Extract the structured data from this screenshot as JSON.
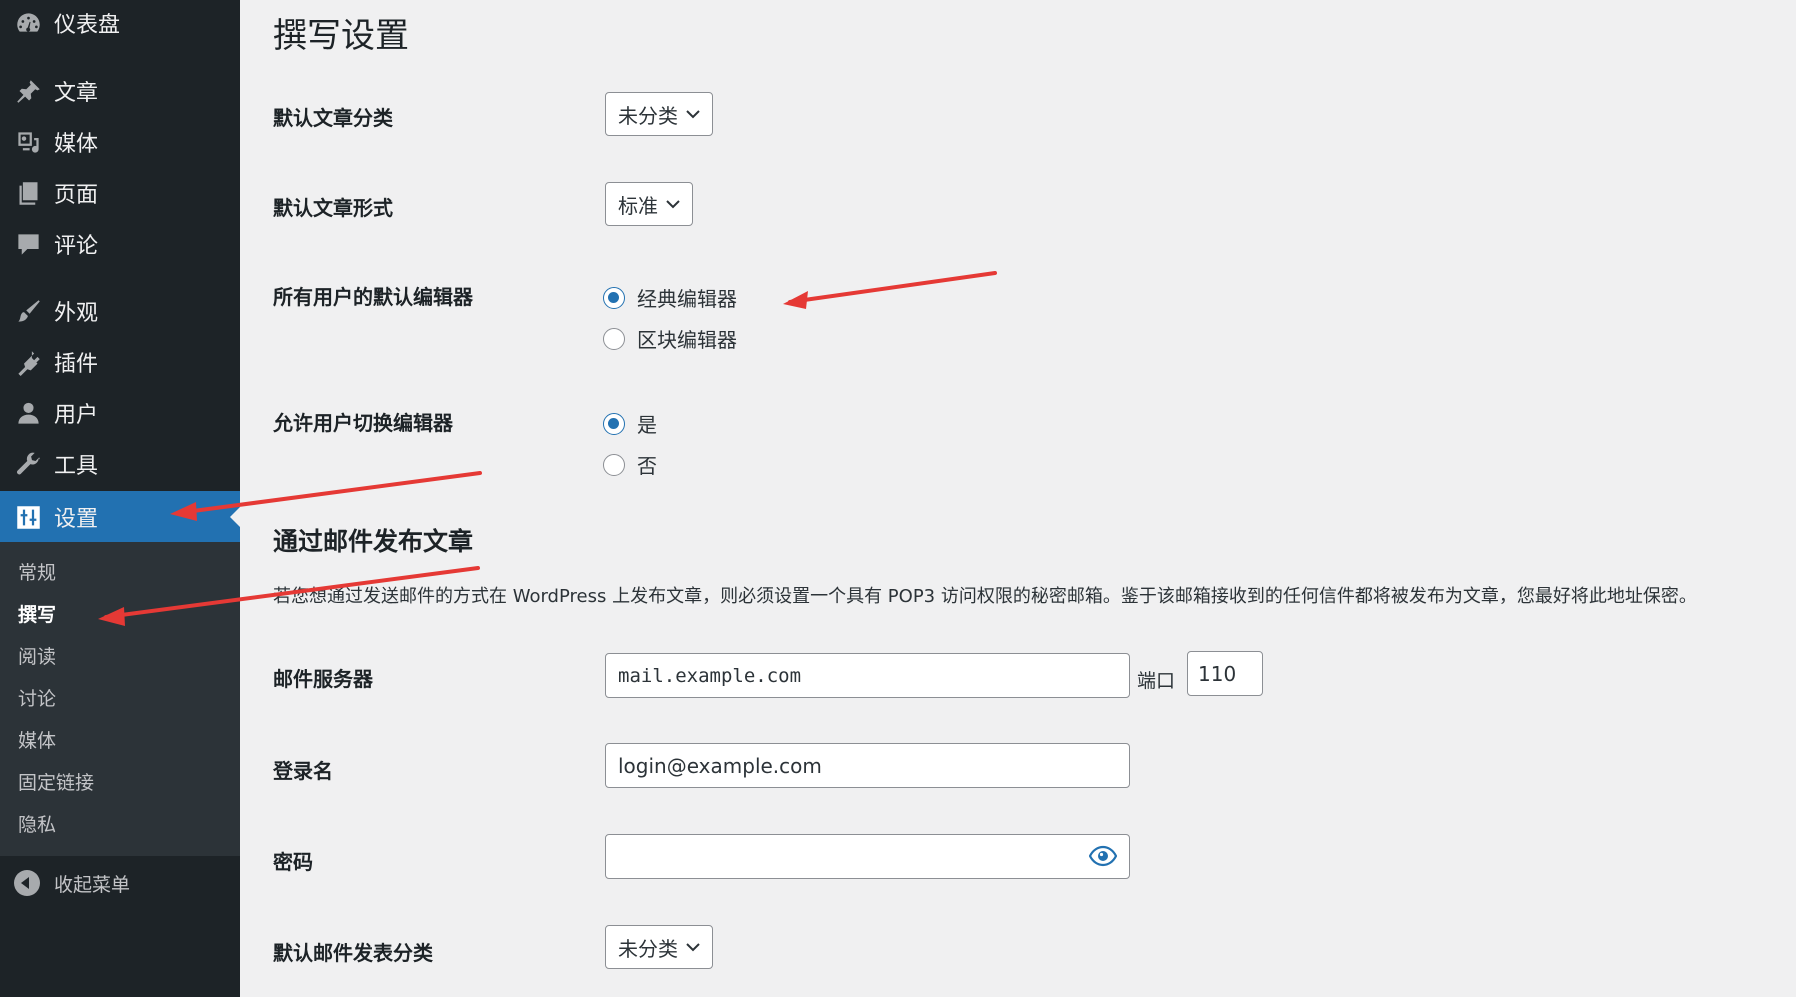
{
  "sidebar": {
    "items": [
      {
        "label": "仪表盘",
        "icon": "dashboard-icon"
      },
      {
        "label": "文章",
        "icon": "pin-icon"
      },
      {
        "label": "媒体",
        "icon": "media-icon"
      },
      {
        "label": "页面",
        "icon": "page-icon"
      },
      {
        "label": "评论",
        "icon": "comment-icon"
      },
      {
        "label": "外观",
        "icon": "brush-icon"
      },
      {
        "label": "插件",
        "icon": "plugin-icon"
      },
      {
        "label": "用户",
        "icon": "user-icon"
      },
      {
        "label": "工具",
        "icon": "wrench-icon"
      },
      {
        "label": "设置",
        "icon": "settings-icon",
        "current": true
      }
    ],
    "submenu": [
      "常规",
      "撰写",
      "阅读",
      "讨论",
      "媒体",
      "固定链接",
      "隐私"
    ],
    "submenu_current": "撰写",
    "collapse_label": "收起菜单"
  },
  "page": {
    "title": "撰写设置",
    "default_category": {
      "label": "默认文章分类",
      "value": "未分类"
    },
    "default_format": {
      "label": "默认文章形式",
      "value": "标准"
    },
    "default_editor": {
      "label": "所有用户的默认编辑器",
      "options": [
        "经典编辑器",
        "区块编辑器"
      ],
      "selected": "经典编辑器"
    },
    "allow_switch": {
      "label": "允许用户切换编辑器",
      "options": [
        "是",
        "否"
      ],
      "selected": "是"
    },
    "email_section": {
      "title": "通过邮件发布文章",
      "description": "若您想通过发送邮件的方式在 WordPress 上发布文章，则必须设置一个具有 POP3 访问权限的秘密邮箱。鉴于该邮箱接收到的任何信件都将被发布为文章，您最好将此地址保密。",
      "mail_server": {
        "label": "邮件服务器",
        "value": "mail.example.com",
        "port_label": "端口",
        "port": "110"
      },
      "login": {
        "label": "登录名",
        "value": "login@example.com"
      },
      "password": {
        "label": "密码",
        "value": ""
      },
      "mail_category": {
        "label": "默认邮件发表分类",
        "value": "未分类"
      }
    }
  },
  "colors": {
    "sidebar_bg": "#1d2327",
    "submenu_bg": "#2c3338",
    "accent": "#2271b1",
    "annotation_arrow": "#e53935",
    "page_bg": "#f0f0f1"
  }
}
